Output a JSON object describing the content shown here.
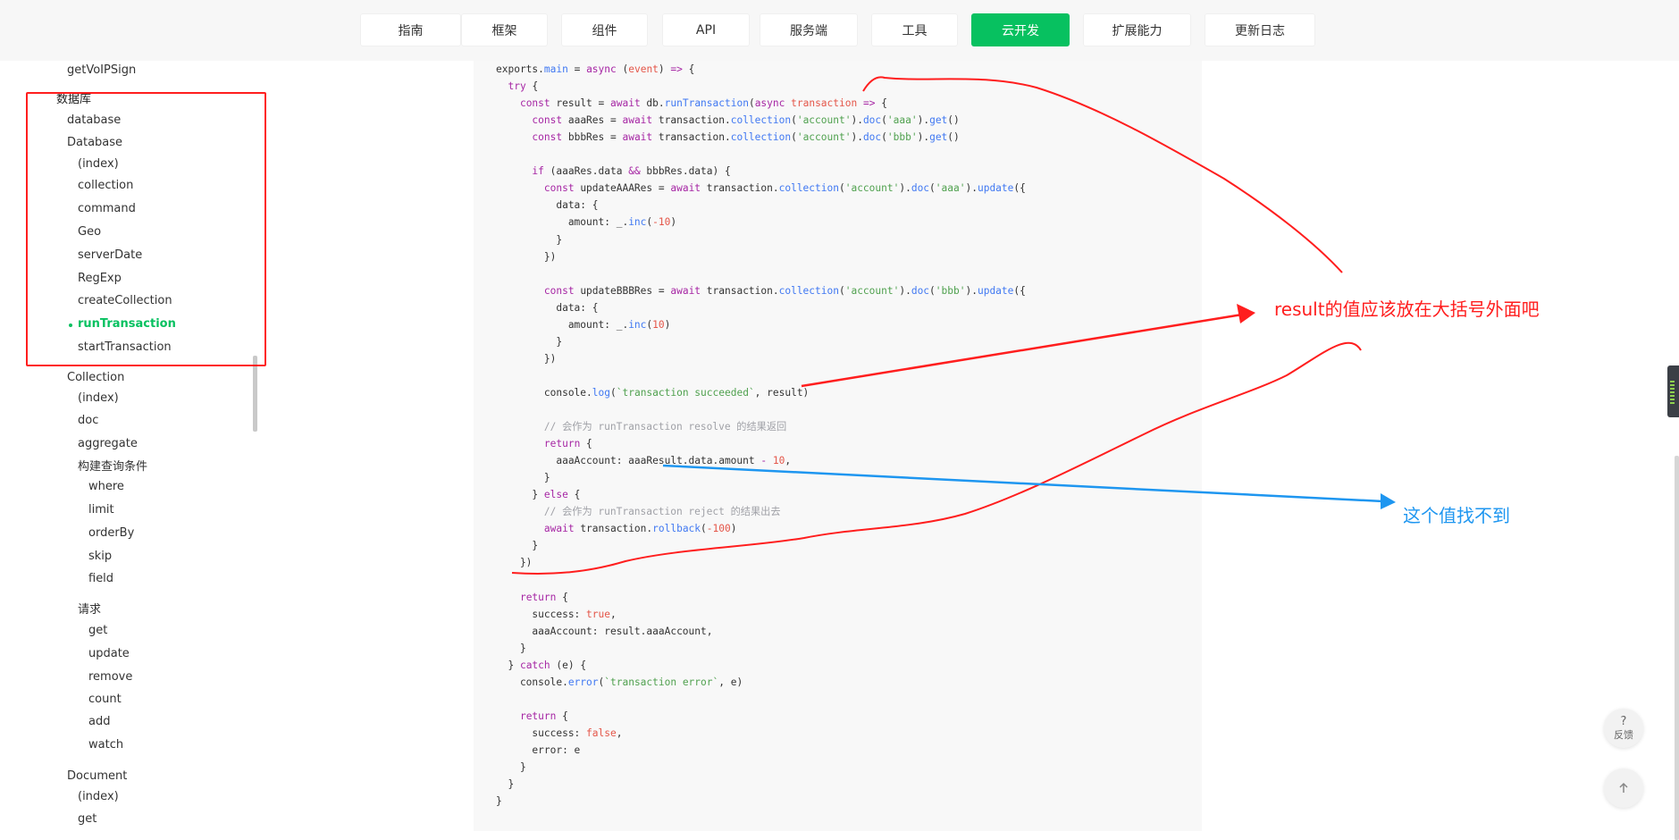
{
  "nav": {
    "tabs": [
      {
        "label": "指南"
      },
      {
        "label": "框架"
      },
      {
        "label": "组件"
      },
      {
        "label": "API"
      },
      {
        "label": "服务端"
      },
      {
        "label": "工具"
      },
      {
        "label": "云开发",
        "active": true
      },
      {
        "label": "扩展能力"
      },
      {
        "label": "更新日志"
      }
    ],
    "accent": "#07c160"
  },
  "sidebar": {
    "items": [
      {
        "label": "getVoIPSign",
        "level": 1
      },
      {
        "label": "数据库",
        "level": 0,
        "heading": true
      },
      {
        "label": "database",
        "level": 1
      },
      {
        "label": "Database",
        "level": 1
      },
      {
        "label": "(index)",
        "level": 2
      },
      {
        "label": "collection",
        "level": 2
      },
      {
        "label": "command",
        "level": 2
      },
      {
        "label": "Geo",
        "level": 2
      },
      {
        "label": "serverDate",
        "level": 2
      },
      {
        "label": "RegExp",
        "level": 2
      },
      {
        "label": "createCollection",
        "level": 2
      },
      {
        "label": "runTransaction",
        "level": 2,
        "active": true
      },
      {
        "label": "startTransaction",
        "level": 2
      },
      {
        "label": "Collection",
        "level": 1
      },
      {
        "label": "(index)",
        "level": 2
      },
      {
        "label": "doc",
        "level": 2
      },
      {
        "label": "aggregate",
        "level": 2
      },
      {
        "label": "构建查询条件",
        "level": 2
      },
      {
        "label": "where",
        "level": 3
      },
      {
        "label": "limit",
        "level": 3
      },
      {
        "label": "orderBy",
        "level": 3
      },
      {
        "label": "skip",
        "level": 3
      },
      {
        "label": "field",
        "level": 3
      },
      {
        "label": "请求",
        "level": 2
      },
      {
        "label": "get",
        "level": 3
      },
      {
        "label": "update",
        "level": 3
      },
      {
        "label": "remove",
        "level": 3
      },
      {
        "label": "count",
        "level": 3
      },
      {
        "label": "add",
        "level": 3
      },
      {
        "label": "watch",
        "level": 3
      },
      {
        "label": "Document",
        "level": 1
      },
      {
        "label": "(index)",
        "level": 2
      },
      {
        "label": "get",
        "level": 2
      }
    ]
  },
  "code": {
    "lines": [
      [
        [
          "p",
          "exports."
        ],
        [
          "f",
          "main"
        ],
        [
          "p",
          " = "
        ],
        [
          "k",
          "async"
        ],
        [
          "p",
          " ("
        ],
        [
          "n",
          "event"
        ],
        [
          "p",
          ") "
        ],
        [
          "k",
          "=>"
        ],
        [
          "p",
          " {"
        ]
      ],
      [
        [
          "p",
          "  "
        ],
        [
          "k",
          "try"
        ],
        [
          "p",
          " {"
        ]
      ],
      [
        [
          "p",
          "    "
        ],
        [
          "k",
          "const"
        ],
        [
          "p",
          " result = "
        ],
        [
          "k",
          "await"
        ],
        [
          "p",
          " db."
        ],
        [
          "f",
          "runTransaction"
        ],
        [
          "p",
          "("
        ],
        [
          "k",
          "async"
        ],
        [
          "p",
          " "
        ],
        [
          "n",
          "transaction"
        ],
        [
          "p",
          " "
        ],
        [
          "k",
          "=>"
        ],
        [
          "p",
          " {"
        ]
      ],
      [
        [
          "p",
          "      "
        ],
        [
          "k",
          "const"
        ],
        [
          "p",
          " aaaRes = "
        ],
        [
          "k",
          "await"
        ],
        [
          "p",
          " transaction."
        ],
        [
          "f",
          "collection"
        ],
        [
          "p",
          "("
        ],
        [
          "s",
          "'account'"
        ],
        [
          "p",
          ")."
        ],
        [
          "f",
          "doc"
        ],
        [
          "p",
          "("
        ],
        [
          "s",
          "'aaa'"
        ],
        [
          "p",
          ")."
        ],
        [
          "f",
          "get"
        ],
        [
          "p",
          "()"
        ]
      ],
      [
        [
          "p",
          "      "
        ],
        [
          "k",
          "const"
        ],
        [
          "p",
          " bbbRes = "
        ],
        [
          "k",
          "await"
        ],
        [
          "p",
          " transaction."
        ],
        [
          "f",
          "collection"
        ],
        [
          "p",
          "("
        ],
        [
          "s",
          "'account'"
        ],
        [
          "p",
          ")."
        ],
        [
          "f",
          "doc"
        ],
        [
          "p",
          "("
        ],
        [
          "s",
          "'bbb'"
        ],
        [
          "p",
          ")."
        ],
        [
          "f",
          "get"
        ],
        [
          "p",
          "()"
        ]
      ],
      [],
      [
        [
          "p",
          "      "
        ],
        [
          "k",
          "if"
        ],
        [
          "p",
          " (aaaRes.data "
        ],
        [
          "k",
          "&&"
        ],
        [
          "p",
          " bbbRes.data) {"
        ]
      ],
      [
        [
          "p",
          "        "
        ],
        [
          "k",
          "const"
        ],
        [
          "p",
          " updateAAARes = "
        ],
        [
          "k",
          "await"
        ],
        [
          "p",
          " transaction."
        ],
        [
          "f",
          "collection"
        ],
        [
          "p",
          "("
        ],
        [
          "s",
          "'account'"
        ],
        [
          "p",
          ")."
        ],
        [
          "f",
          "doc"
        ],
        [
          "p",
          "("
        ],
        [
          "s",
          "'aaa'"
        ],
        [
          "p",
          ")."
        ],
        [
          "f",
          "update"
        ],
        [
          "p",
          "({"
        ]
      ],
      [
        [
          "p",
          "          data: {"
        ]
      ],
      [
        [
          "p",
          "            amount: _."
        ],
        [
          "f",
          "inc"
        ],
        [
          "p",
          "("
        ],
        [
          "n",
          "-10"
        ],
        [
          "p",
          ")"
        ]
      ],
      [
        [
          "p",
          "          }"
        ]
      ],
      [
        [
          "p",
          "        })"
        ]
      ],
      [],
      [
        [
          "p",
          "        "
        ],
        [
          "k",
          "const"
        ],
        [
          "p",
          " updateBBBRes = "
        ],
        [
          "k",
          "await"
        ],
        [
          "p",
          " transaction."
        ],
        [
          "f",
          "collection"
        ],
        [
          "p",
          "("
        ],
        [
          "s",
          "'account'"
        ],
        [
          "p",
          ")."
        ],
        [
          "f",
          "doc"
        ],
        [
          "p",
          "("
        ],
        [
          "s",
          "'bbb'"
        ],
        [
          "p",
          ")."
        ],
        [
          "f",
          "update"
        ],
        [
          "p",
          "({"
        ]
      ],
      [
        [
          "p",
          "          data: {"
        ]
      ],
      [
        [
          "p",
          "            amount: _."
        ],
        [
          "f",
          "inc"
        ],
        [
          "p",
          "("
        ],
        [
          "n",
          "10"
        ],
        [
          "p",
          ")"
        ]
      ],
      [
        [
          "p",
          "          }"
        ]
      ],
      [
        [
          "p",
          "        })"
        ]
      ],
      [],
      [
        [
          "p",
          "        console."
        ],
        [
          "f",
          "log"
        ],
        [
          "p",
          "("
        ],
        [
          "s",
          "`transaction succeeded`"
        ],
        [
          "p",
          ", result)"
        ]
      ],
      [],
      [
        [
          "c",
          "        // 会作为 runTransaction resolve 的结果返回"
        ]
      ],
      [
        [
          "p",
          "        "
        ],
        [
          "k",
          "return"
        ],
        [
          "p",
          " {"
        ]
      ],
      [
        [
          "p",
          "          aaaAccount: aaaResult.data.amount "
        ],
        [
          "k",
          "-"
        ],
        [
          "p",
          " "
        ],
        [
          "n",
          "10"
        ],
        [
          "p",
          ","
        ]
      ],
      [
        [
          "p",
          "        }"
        ]
      ],
      [
        [
          "p",
          "      } "
        ],
        [
          "k",
          "else"
        ],
        [
          "p",
          " {"
        ]
      ],
      [
        [
          "c",
          "        // 会作为 runTransaction reject 的结果出去"
        ]
      ],
      [
        [
          "p",
          "        "
        ],
        [
          "k",
          "await"
        ],
        [
          "p",
          " transaction."
        ],
        [
          "f",
          "rollback"
        ],
        [
          "p",
          "("
        ],
        [
          "n",
          "-100"
        ],
        [
          "p",
          ")"
        ]
      ],
      [
        [
          "p",
          "      }"
        ]
      ],
      [
        [
          "p",
          "    })"
        ]
      ],
      [],
      [
        [
          "p",
          "    "
        ],
        [
          "k",
          "return"
        ],
        [
          "p",
          " {"
        ]
      ],
      [
        [
          "p",
          "      success: "
        ],
        [
          "n",
          "true"
        ],
        [
          "p",
          ","
        ]
      ],
      [
        [
          "p",
          "      aaaAccount: result.aaaAccount,"
        ]
      ],
      [
        [
          "p",
          "    }"
        ]
      ],
      [
        [
          "p",
          "  } "
        ],
        [
          "k",
          "catch"
        ],
        [
          "p",
          " (e) {"
        ]
      ],
      [
        [
          "p",
          "    console."
        ],
        [
          "f",
          "error"
        ],
        [
          "p",
          "("
        ],
        [
          "s",
          "`transaction error`"
        ],
        [
          "p",
          ", e)"
        ]
      ],
      [],
      [
        [
          "p",
          "    "
        ],
        [
          "k",
          "return"
        ],
        [
          "p",
          " {"
        ]
      ],
      [
        [
          "p",
          "      success: "
        ],
        [
          "n",
          "false"
        ],
        [
          "p",
          ","
        ]
      ],
      [
        [
          "p",
          "      error: e"
        ]
      ],
      [
        [
          "p",
          "    }"
        ]
      ],
      [
        [
          "p",
          "  }"
        ]
      ],
      [
        [
          "p",
          "}"
        ]
      ]
    ]
  },
  "annotations": {
    "red_note": "result的值应该放在大括号外面吧",
    "blue_note": "这个值找不到",
    "red_color": "#ff1e1e",
    "blue_color": "#1e96f0"
  },
  "floating": {
    "feedback_glyph": "?",
    "feedback_label": "反馈",
    "back_to_top_icon": "arrow-up-icon"
  }
}
